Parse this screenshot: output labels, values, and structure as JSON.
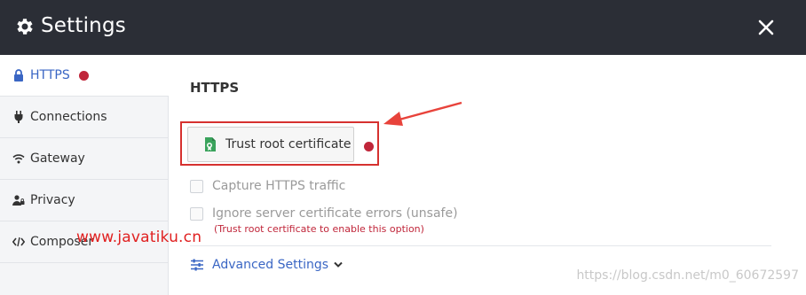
{
  "window": {
    "title": "Settings",
    "icons": {
      "settings": "gear-icon",
      "close": "close-icon"
    }
  },
  "sidebar": {
    "items": [
      {
        "label": "HTTPS",
        "icon": "lock-icon",
        "active": true,
        "has_alert_dot": true
      },
      {
        "label": "Connections",
        "icon": "plug-icon",
        "active": false
      },
      {
        "label": "Gateway",
        "icon": "wifi-icon",
        "active": false
      },
      {
        "label": "Privacy",
        "icon": "user-privacy-icon",
        "active": false
      },
      {
        "label": "Composer",
        "icon": "code-icon",
        "active": false
      }
    ]
  },
  "main": {
    "section_title": "HTTPS",
    "trust_button_label": "Trust root certificate",
    "trust_button_icon": "certificate-icon",
    "options": [
      {
        "label": "Capture HTTPS traffic",
        "checked": false,
        "disabled": true
      },
      {
        "label": "Ignore server certificate errors (unsafe)",
        "checked": false,
        "disabled": true
      }
    ],
    "warning": "(Trust root certificate to enable this option)",
    "advanced_label": "Advanced Settings"
  },
  "overlays": {
    "watermark": "www.javatiku.cn",
    "csdn": "https://blog.csdn.net/m0_60672597"
  },
  "colors": {
    "titlebar": "#2b2e36",
    "accent": "#3a66c4",
    "alert": "#c0263a",
    "annotation": "#d6312f"
  }
}
